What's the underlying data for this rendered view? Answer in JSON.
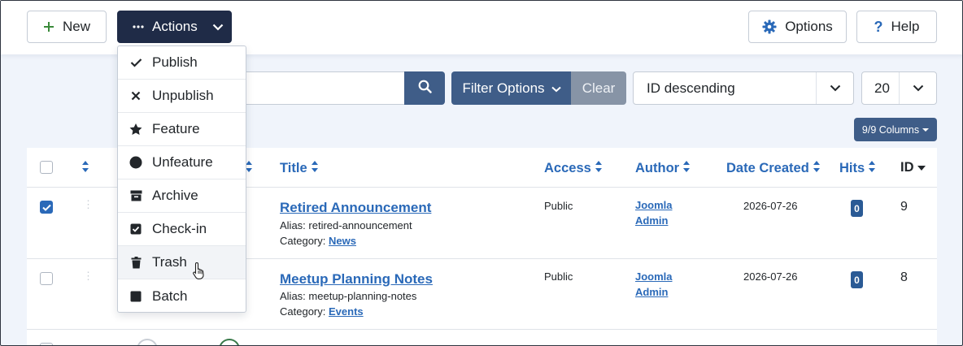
{
  "toolbar": {
    "new_label": "New",
    "actions_label": "Actions",
    "options_label": "Options",
    "help_label": "Help"
  },
  "actions_menu": {
    "items": [
      {
        "label": "Publish",
        "icon": "check-icon"
      },
      {
        "label": "Unpublish",
        "icon": "x-icon"
      },
      {
        "label": "Feature",
        "icon": "star-icon"
      },
      {
        "label": "Unfeature",
        "icon": "circle-icon"
      },
      {
        "label": "Archive",
        "icon": "archive-icon"
      },
      {
        "label": "Check-in",
        "icon": "check-square-icon"
      },
      {
        "label": "Trash",
        "icon": "trash-icon"
      },
      {
        "label": "Batch",
        "icon": "square-icon"
      }
    ],
    "hovered": "Trash"
  },
  "filters": {
    "search_placeholder": "Search",
    "filter_options_label": "Filter Options",
    "clear_label": "Clear",
    "ordering_value": "ID descending",
    "limit_value": "20",
    "columns_label": "9/9 Columns"
  },
  "table": {
    "headers": {
      "title": "Title",
      "access": "Access",
      "author": "Author",
      "date_created": "Date Created",
      "hits": "Hits",
      "id": "ID"
    },
    "rows": [
      {
        "checked": true,
        "title": "Retired Announcement",
        "alias_label": "Alias:",
        "alias": "retired-announcement",
        "category_label": "Category:",
        "category": "News",
        "access": "Public",
        "author_first": "Joomla",
        "author_last": "Admin",
        "date": "2026-07-26",
        "hits": "0",
        "id": "9"
      },
      {
        "checked": false,
        "title": "Meetup Planning Notes",
        "alias_label": "Alias:",
        "alias": "meetup-planning-notes",
        "category_label": "Category:",
        "category": "Events",
        "access": "Public",
        "author_first": "Joomla",
        "author_last": "Admin",
        "date": "2026-07-26",
        "hits": "0",
        "id": "8"
      }
    ]
  },
  "colors": {
    "dark_button": "#1f2b47",
    "primary": "#3f5d88",
    "link": "#2a69b8",
    "clear_button": "#8794a6"
  }
}
